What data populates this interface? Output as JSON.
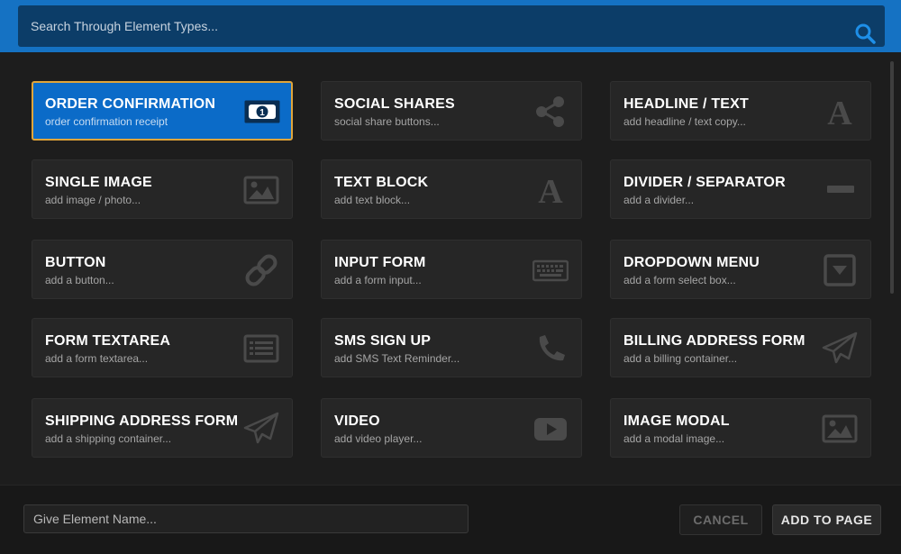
{
  "search": {
    "placeholder": "Search Through Element Types..."
  },
  "elements": [
    {
      "title": "ORDER CONFIRMATION",
      "subtitle": "order confirmation receipt",
      "icon": "money-bill-icon",
      "selected": true
    },
    {
      "title": "SOCIAL SHARES",
      "subtitle": "social share buttons...",
      "icon": "share-icon"
    },
    {
      "title": "HEADLINE / TEXT",
      "subtitle": "add headline / text copy...",
      "icon": "font-icon"
    },
    {
      "title": "SINGLE IMAGE",
      "subtitle": "add image / photo...",
      "icon": "image-icon"
    },
    {
      "title": "TEXT BLOCK",
      "subtitle": "add text block...",
      "icon": "font-icon"
    },
    {
      "title": "DIVIDER / SEPARATOR",
      "subtitle": "add a divider...",
      "icon": "minus-icon"
    },
    {
      "title": "BUTTON",
      "subtitle": "add a button...",
      "icon": "link-icon"
    },
    {
      "title": "INPUT FORM",
      "subtitle": "add a form input...",
      "icon": "keyboard-icon"
    },
    {
      "title": "DROPDOWN MENU",
      "subtitle": "add a form select box...",
      "icon": "dropdown-icon"
    },
    {
      "title": "FORM TEXTAREA",
      "subtitle": "add a form textarea...",
      "icon": "list-alt-icon"
    },
    {
      "title": "SMS SIGN UP",
      "subtitle": "add SMS Text Reminder...",
      "icon": "phone-icon"
    },
    {
      "title": "BILLING ADDRESS FORM",
      "subtitle": "add a billing container...",
      "icon": "paper-plane-icon"
    },
    {
      "title": "SHIPPING ADDRESS FORM",
      "subtitle": "add a shipping container...",
      "icon": "paper-plane-icon"
    },
    {
      "title": "VIDEO",
      "subtitle": "add video player...",
      "icon": "youtube-play-icon"
    },
    {
      "title": "IMAGE MODAL",
      "subtitle": "add a modal image...",
      "icon": "image-icon"
    }
  ],
  "footer": {
    "name_placeholder": "Give Element Name...",
    "cancel_label": "CANCEL",
    "add_label": "ADD TO PAGE"
  },
  "colors": {
    "accent": "#1572c3",
    "selected_card": "#0b6bc8",
    "selected_border": "#e0a53a",
    "icon_muted": "#4a4a4a"
  }
}
